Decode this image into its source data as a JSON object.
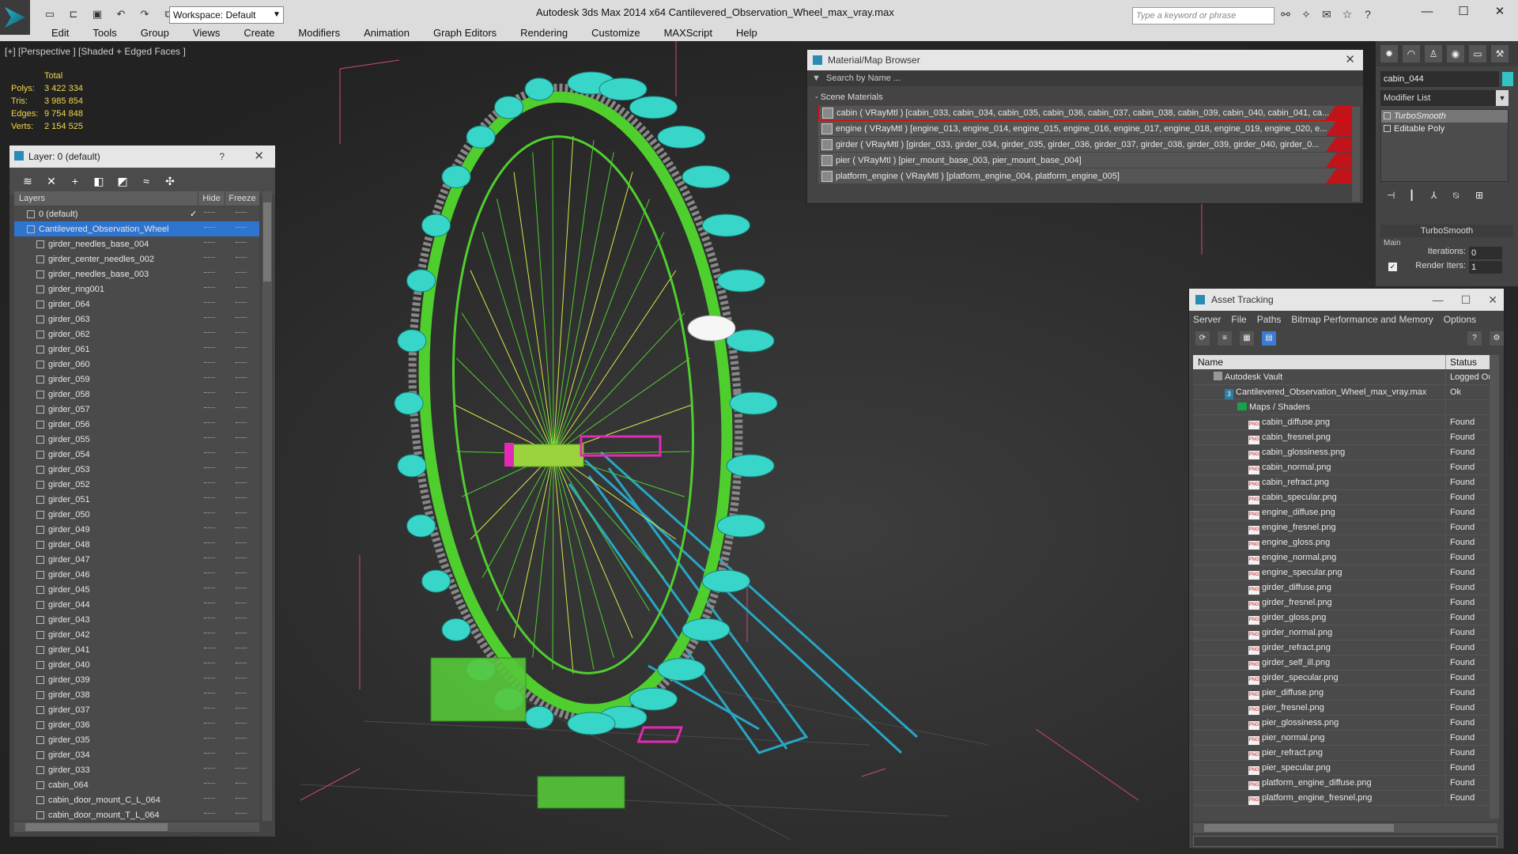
{
  "app": {
    "title": "Autodesk 3ds Max  2014 x64      Cantilevered_Observation_Wheel_max_vray.max",
    "workspace": "Workspace: Default",
    "search_placeholder": "Type a keyword or phrase",
    "win_min": "—",
    "win_max": "☐",
    "win_close": "✕"
  },
  "menu": [
    "Edit",
    "Tools",
    "Group",
    "Views",
    "Create",
    "Modifiers",
    "Animation",
    "Graph Editors",
    "Rendering",
    "Customize",
    "MAXScript",
    "Help"
  ],
  "viewport": {
    "label": "[+] [Perspective ] [Shaded + Edged Faces ]",
    "stats_header": "Total",
    "stats": [
      {
        "k": "Polys:",
        "v": "3 422 334"
      },
      {
        "k": "Tris:",
        "v": "3 985 854"
      },
      {
        "k": "Edges:",
        "v": "9 754 848"
      },
      {
        "k": "Verts:",
        "v": "2 154 525"
      }
    ]
  },
  "layers": {
    "title": "Layer: 0 (default)",
    "help": "?",
    "close": "✕",
    "col_layers": "Layers",
    "col_hide": "Hide",
    "col_freeze": "Freeze",
    "rows": [
      {
        "name": "0 (default)",
        "indent": 16,
        "check": "✓"
      },
      {
        "name": "Cantilevered_Observation_Wheel",
        "indent": 16,
        "selected": true
      },
      {
        "name": "girder_needles_base_004",
        "indent": 28
      },
      {
        "name": "girder_center_needles_002",
        "indent": 28
      },
      {
        "name": "girder_needles_base_003",
        "indent": 28
      },
      {
        "name": "girder_ring001",
        "indent": 28
      },
      {
        "name": "girder_064",
        "indent": 28
      },
      {
        "name": "girder_063",
        "indent": 28
      },
      {
        "name": "girder_062",
        "indent": 28
      },
      {
        "name": "girder_061",
        "indent": 28
      },
      {
        "name": "girder_060",
        "indent": 28
      },
      {
        "name": "girder_059",
        "indent": 28
      },
      {
        "name": "girder_058",
        "indent": 28
      },
      {
        "name": "girder_057",
        "indent": 28
      },
      {
        "name": "girder_056",
        "indent": 28
      },
      {
        "name": "girder_055",
        "indent": 28
      },
      {
        "name": "girder_054",
        "indent": 28
      },
      {
        "name": "girder_053",
        "indent": 28
      },
      {
        "name": "girder_052",
        "indent": 28
      },
      {
        "name": "girder_051",
        "indent": 28
      },
      {
        "name": "girder_050",
        "indent": 28
      },
      {
        "name": "girder_049",
        "indent": 28
      },
      {
        "name": "girder_048",
        "indent": 28
      },
      {
        "name": "girder_047",
        "indent": 28
      },
      {
        "name": "girder_046",
        "indent": 28
      },
      {
        "name": "girder_045",
        "indent": 28
      },
      {
        "name": "girder_044",
        "indent": 28
      },
      {
        "name": "girder_043",
        "indent": 28
      },
      {
        "name": "girder_042",
        "indent": 28
      },
      {
        "name": "girder_041",
        "indent": 28
      },
      {
        "name": "girder_040",
        "indent": 28
      },
      {
        "name": "girder_039",
        "indent": 28
      },
      {
        "name": "girder_038",
        "indent": 28
      },
      {
        "name": "girder_037",
        "indent": 28
      },
      {
        "name": "girder_036",
        "indent": 28
      },
      {
        "name": "girder_035",
        "indent": 28
      },
      {
        "name": "girder_034",
        "indent": 28
      },
      {
        "name": "girder_033",
        "indent": 28
      },
      {
        "name": "cabin_064",
        "indent": 28
      },
      {
        "name": "cabin_door_mount_C_L_064",
        "indent": 28
      },
      {
        "name": "cabin_door_mount_T_L_064",
        "indent": 28
      }
    ]
  },
  "materials": {
    "title": "Material/Map Browser",
    "close": "✕",
    "search": "Search by Name ...",
    "section": "- Scene Materials",
    "rows": [
      "cabin  ( VRayMtl )  [cabin_033, cabin_034, cabin_035, cabin_036, cabin_037, cabin_038, cabin_039, cabin_040, cabin_041, ca...",
      "engine  ( VRayMtl )  [engine_013, engine_014, engine_015, engine_016, engine_017, engine_018, engine_019, engine_020, e...",
      "girder  ( VRayMtl ) [girder_033, girder_034, girder_035, girder_036, girder_037, girder_038, girder_039, girder_040, girder_0...",
      "pier  ( VRayMtl ) [pier_mount_base_003, pier_mount_base_004]",
      "platform_engine  ( VRayMtl ) [platform_engine_004, platform_engine_005]"
    ]
  },
  "command": {
    "object_name": "cabin_044",
    "modifier_list": "Modifier List",
    "stack": [
      "TurboSmooth",
      "Editable Poly"
    ],
    "rollout": "TurboSmooth",
    "main": "Main",
    "iterations_label": "Iterations:",
    "iterations": "0",
    "render_iters_label": "Render Iters:",
    "render_iters": "1",
    "color": "#33c3c3"
  },
  "assets": {
    "title": "Asset Tracking",
    "menu": [
      "Server",
      "File",
      "Paths",
      "Bitmap Performance and Memory",
      "Options"
    ],
    "col_name": "Name",
    "col_status": "Status",
    "rows": [
      {
        "name": "Autodesk Vault",
        "status": "Logged Ou",
        "icon": "vault",
        "indent": 26
      },
      {
        "name": "Cantilevered_Observation_Wheel_max_vray.max",
        "status": "Ok",
        "icon": "max",
        "indent": 40
      },
      {
        "name": "Maps / Shaders",
        "status": "",
        "icon": "folder",
        "indent": 56
      },
      {
        "name": "cabin_diffuse.png",
        "status": "Found",
        "icon": "png",
        "indent": 70
      },
      {
        "name": "cabin_fresnel.png",
        "status": "Found",
        "icon": "png",
        "indent": 70
      },
      {
        "name": "cabin_glossiness.png",
        "status": "Found",
        "icon": "png",
        "indent": 70
      },
      {
        "name": "cabin_normal.png",
        "status": "Found",
        "icon": "png",
        "indent": 70
      },
      {
        "name": "cabin_refract.png",
        "status": "Found",
        "icon": "png",
        "indent": 70
      },
      {
        "name": "cabin_specular.png",
        "status": "Found",
        "icon": "png",
        "indent": 70
      },
      {
        "name": "engine_diffuse.png",
        "status": "Found",
        "icon": "png",
        "indent": 70
      },
      {
        "name": "engine_fresnel.png",
        "status": "Found",
        "icon": "png",
        "indent": 70
      },
      {
        "name": "engine_gloss.png",
        "status": "Found",
        "icon": "png",
        "indent": 70
      },
      {
        "name": "engine_normal.png",
        "status": "Found",
        "icon": "png",
        "indent": 70
      },
      {
        "name": "engine_specular.png",
        "status": "Found",
        "icon": "png",
        "indent": 70
      },
      {
        "name": "girder_diffuse.png",
        "status": "Found",
        "icon": "png",
        "indent": 70
      },
      {
        "name": "girder_fresnel.png",
        "status": "Found",
        "icon": "png",
        "indent": 70
      },
      {
        "name": "girder_gloss.png",
        "status": "Found",
        "icon": "png",
        "indent": 70
      },
      {
        "name": "girder_normal.png",
        "status": "Found",
        "icon": "png",
        "indent": 70
      },
      {
        "name": "girder_refract.png",
        "status": "Found",
        "icon": "png",
        "indent": 70
      },
      {
        "name": "girder_self_ill.png",
        "status": "Found",
        "icon": "png",
        "indent": 70
      },
      {
        "name": "girder_specular.png",
        "status": "Found",
        "icon": "png",
        "indent": 70
      },
      {
        "name": "pier_diffuse.png",
        "status": "Found",
        "icon": "png",
        "indent": 70
      },
      {
        "name": "pier_fresnel.png",
        "status": "Found",
        "icon": "png",
        "indent": 70
      },
      {
        "name": "pier_glossiness.png",
        "status": "Found",
        "icon": "png",
        "indent": 70
      },
      {
        "name": "pier_normal.png",
        "status": "Found",
        "icon": "png",
        "indent": 70
      },
      {
        "name": "pier_refract.png",
        "status": "Found",
        "icon": "png",
        "indent": 70
      },
      {
        "name": "pier_specular.png",
        "status": "Found",
        "icon": "png",
        "indent": 70
      },
      {
        "name": "platform_engine_diffuse.png",
        "status": "Found",
        "icon": "png",
        "indent": 70
      },
      {
        "name": "platform_engine_fresnel.png",
        "status": "Found",
        "icon": "png",
        "indent": 70
      }
    ]
  }
}
